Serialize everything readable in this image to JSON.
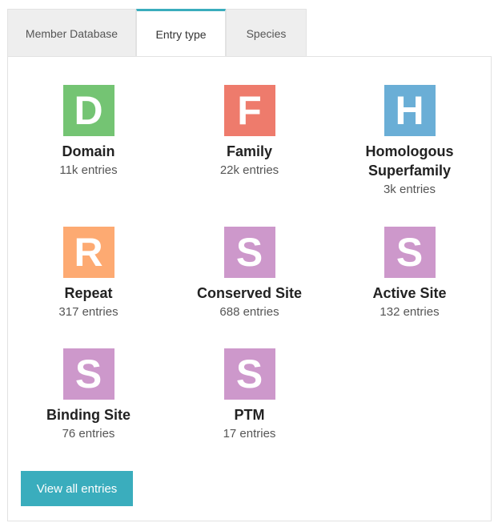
{
  "tabs": [
    {
      "label": "Member Database",
      "active": false
    },
    {
      "label": "Entry type",
      "active": true
    },
    {
      "label": "Species",
      "active": false
    }
  ],
  "colors": {
    "accent": "#3aadbd",
    "domain": "#74c473",
    "family": "#ee7b6c",
    "homologous": "#6aaed6",
    "repeat": "#fdaa72",
    "site": "#cd98cb"
  },
  "entry_types": [
    {
      "letter": "D",
      "title": "Domain",
      "count": "11k entries",
      "color": "#74c473"
    },
    {
      "letter": "F",
      "title": "Family",
      "count": "22k entries",
      "color": "#ee7b6c"
    },
    {
      "letter": "H",
      "title": "Homologous Superfamily",
      "count": "3k entries",
      "color": "#6aaed6"
    },
    {
      "letter": "R",
      "title": "Repeat",
      "count": "317 entries",
      "color": "#fdaa72"
    },
    {
      "letter": "S",
      "title": "Conserved Site",
      "count": "688 entries",
      "color": "#cd98cb"
    },
    {
      "letter": "S",
      "title": "Active Site",
      "count": "132 entries",
      "color": "#cd98cb"
    },
    {
      "letter": "S",
      "title": "Binding Site",
      "count": "76 entries",
      "color": "#cd98cb"
    },
    {
      "letter": "S",
      "title": "PTM",
      "count": "17 entries",
      "color": "#cd98cb"
    }
  ],
  "view_all_label": "View all entries"
}
